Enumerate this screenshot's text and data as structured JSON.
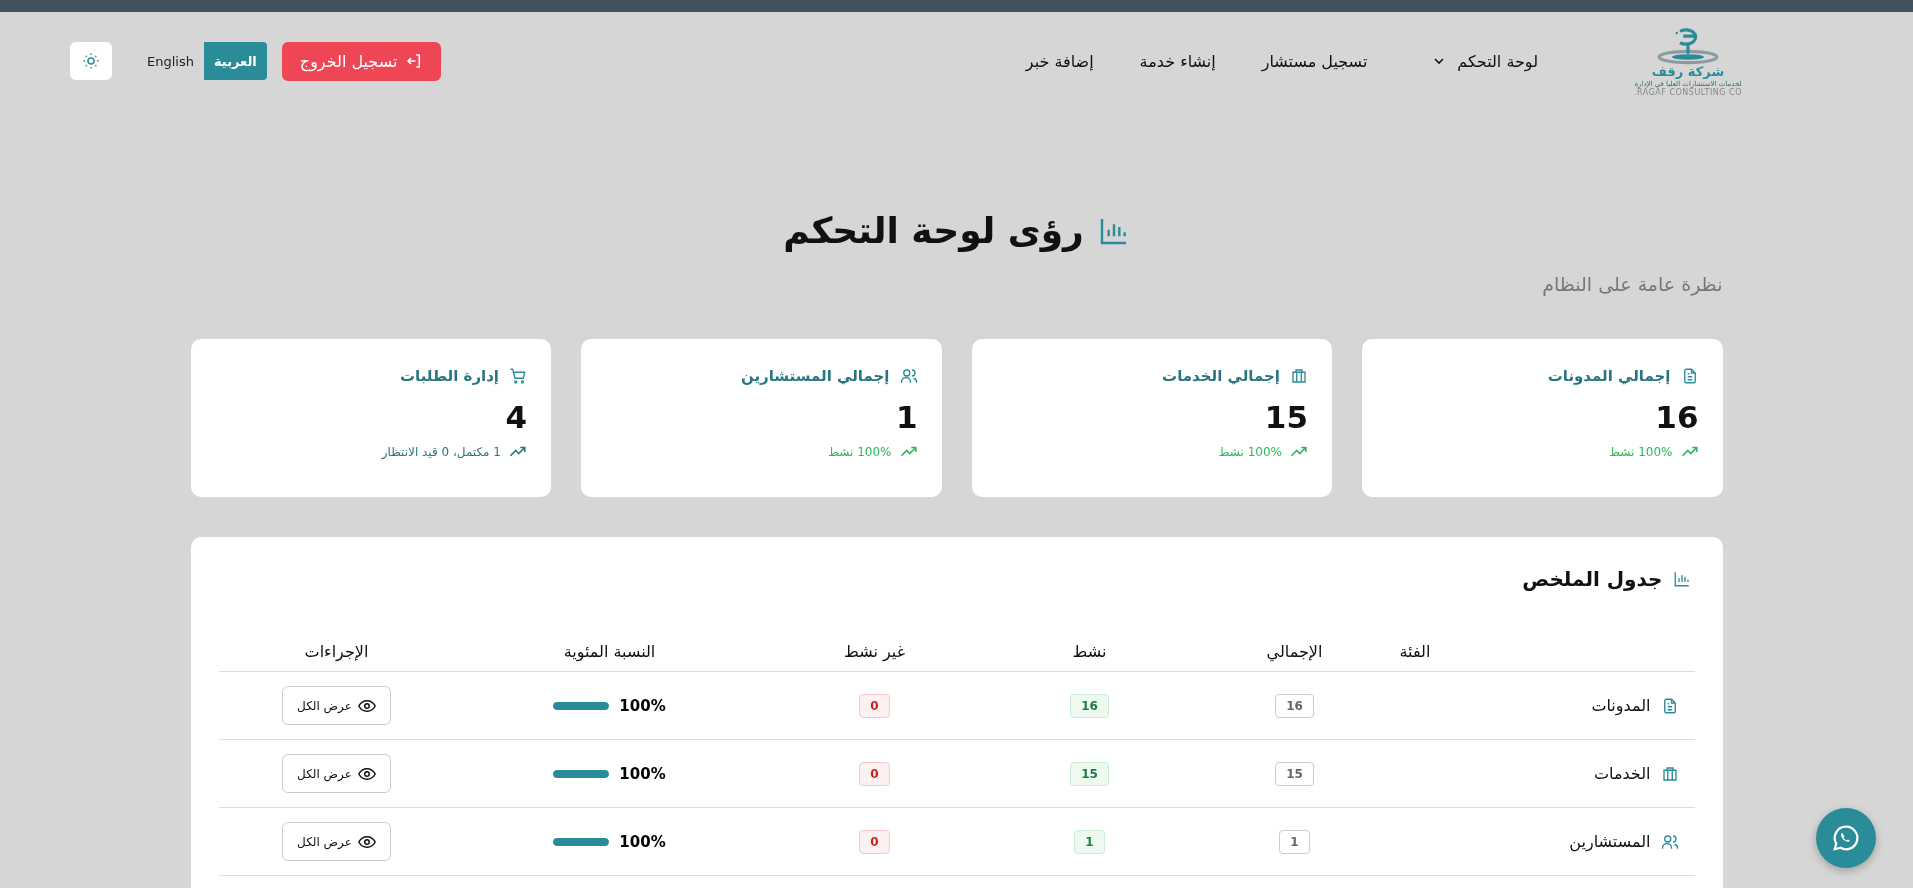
{
  "logo": {
    "name": "شركة رقف",
    "tagline": "لخدمات الاستشارات العليا في الإدارة",
    "english": "RAGAF CONSULTING CO."
  },
  "nav": [
    {
      "label": "لوحة التحكم",
      "dropdown": true
    },
    {
      "label": "تسجيل مستشار",
      "dropdown": false
    },
    {
      "label": "إنشاء خدمة",
      "dropdown": false
    },
    {
      "label": "إضافة خبر",
      "dropdown": false
    }
  ],
  "logout_button": "تسجيل الخروج",
  "languages": [
    {
      "label": "العربية",
      "selected": true
    },
    {
      "label": "English",
      "selected": false
    }
  ],
  "page": {
    "title": "رؤى لوحة التحكم",
    "subtitle": "نظرة عامة على النظام"
  },
  "stats": [
    {
      "kind": "document",
      "title": "إجمالي المدونات",
      "value": "16",
      "trend": "100% نشط",
      "color": "#2fb55c"
    },
    {
      "kind": "briefcase",
      "title": "إجمالي الخدمات",
      "value": "15",
      "trend": "100% نشط",
      "color": "#2fb55c"
    },
    {
      "kind": "users",
      "title": "إجمالي المستشارين",
      "value": "1",
      "trend": "100% نشط",
      "color": "#2fb55c"
    },
    {
      "kind": "cart",
      "title": "إدارة الطلبات",
      "value": "4",
      "trend": "1 مكتمل، 0 قيد الانتظار",
      "color": "#2a7680"
    }
  ],
  "summary": {
    "title": "جدول الملخص",
    "columns": [
      "الفئة",
      "الإجمالي",
      "نشط",
      "غير نشط",
      "النسبة المئوية",
      "الإجراءات"
    ],
    "rows": [
      {
        "kind": "document",
        "category": "المدونات",
        "total": "16",
        "active": "16",
        "inactive": "0",
        "percent": "100%",
        "level": 1,
        "action": "عرض الكل"
      },
      {
        "kind": "briefcase",
        "category": "الخدمات",
        "total": "15",
        "active": "15",
        "inactive": "0",
        "percent": "100%",
        "level": 1,
        "action": "عرض الكل"
      },
      {
        "kind": "users",
        "category": "المستشارين",
        "total": "1",
        "active": "1",
        "inactive": "0",
        "percent": "100%",
        "level": 1,
        "action": "عرض الكل"
      }
    ]
  }
}
